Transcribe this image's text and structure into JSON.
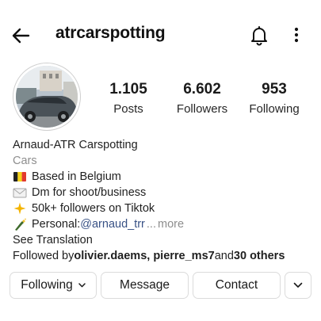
{
  "header": {
    "username": "atrcarspotting",
    "back_icon": "arrow-left-icon",
    "notifications_icon": "bell-icon",
    "more_icon": "vertical-dots-icon"
  },
  "profile": {
    "avatar_icon": "car-photo-avatar",
    "stats": {
      "posts": {
        "value": "1.105",
        "label": "Posts"
      },
      "followers": {
        "value": "6.602",
        "label": "Followers"
      },
      "following": {
        "value": "953",
        "label": "Following"
      }
    },
    "bio": {
      "name": "Arnaud-ATR Carspotting",
      "category": "Cars",
      "lines": [
        {
          "emoji": "belgium-flag",
          "text": "Based in Belgium"
        },
        {
          "emoji": "envelope",
          "text": "Dm for shoot/business"
        },
        {
          "emoji": "sparkle",
          "text": "50k+ followers on Tiktok"
        }
      ],
      "personal": {
        "emoji": "champagne-bottle",
        "prefix": "Personal: ",
        "mention": "@arnaud_trr",
        "ellipsis": "...",
        "more": "more"
      },
      "see_translation": "See Translation",
      "followed_by": {
        "prefix": "Followed by ",
        "users": "olivier.daems, pierre_ms7",
        "conjunction": " and ",
        "others": "30 others"
      }
    }
  },
  "actions": {
    "following": "Following",
    "message": "Message",
    "contact": "Contact",
    "suggest_icon": "chevron-down-icon"
  },
  "colors": {
    "text": "#262626",
    "muted": "#8e8e8e",
    "mention": "#385185",
    "border": "#dbdbdb"
  }
}
